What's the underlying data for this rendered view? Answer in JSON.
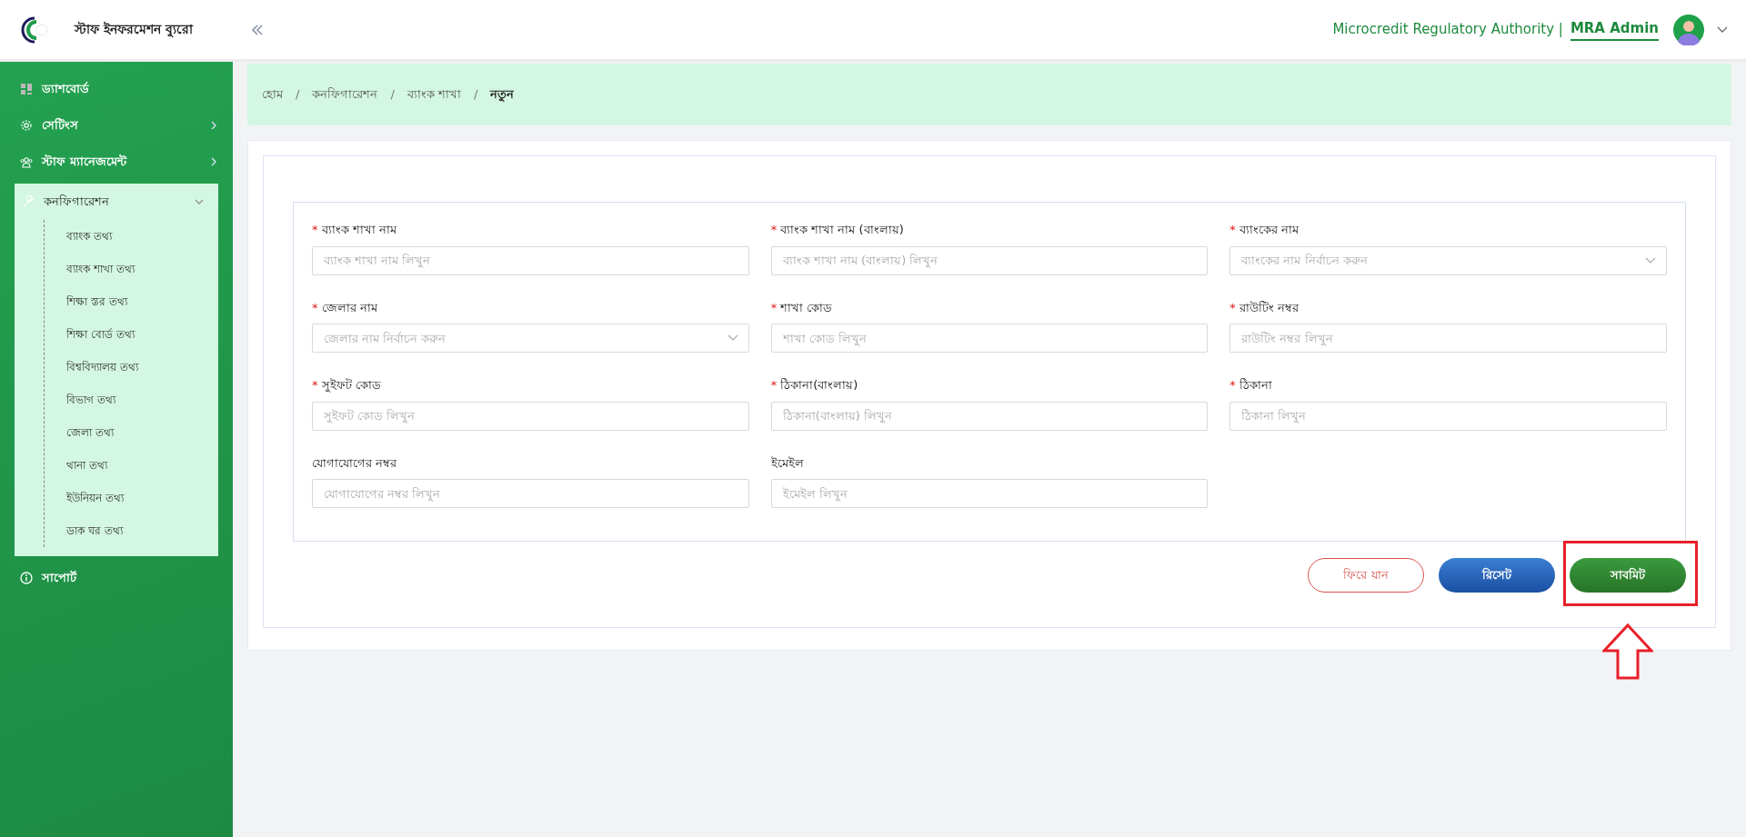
{
  "header": {
    "app_title": "স্টাফ ইনফরমেশন ব্যুরো",
    "organization": "Microcredit Regulatory Authority |",
    "user": "MRA Admin"
  },
  "sidebar": {
    "items": [
      {
        "label": "ড্যাশবোর্ড",
        "kind": "link"
      },
      {
        "label": "সেটিংস",
        "kind": "group",
        "expanded": false
      },
      {
        "label": "স্টাফ ম্যানেজমেন্ট",
        "kind": "group",
        "expanded": false
      },
      {
        "label": "কনফিগারেশন",
        "kind": "group",
        "expanded": true,
        "children": [
          {
            "label": "ব্যাংক তথ্য"
          },
          {
            "label": "ব্যাংক শাখা তথ্য"
          },
          {
            "label": "শিক্ষা স্তর তথ্য"
          },
          {
            "label": "শিক্ষা বোর্ড তথ্য"
          },
          {
            "label": "বিশ্ববিদ্যালয় তথ্য"
          },
          {
            "label": "বিভাগ তথ্য"
          },
          {
            "label": "জেলা তথ্য"
          },
          {
            "label": "থানা তথ্য"
          },
          {
            "label": "ইউনিয়ন তথ্য"
          },
          {
            "label": "ডাক ঘর তথ্য"
          }
        ]
      },
      {
        "label": "সাপোর্ট",
        "kind": "link"
      }
    ]
  },
  "breadcrumb": [
    {
      "label": "হোম",
      "current": false
    },
    {
      "separator": "/",
      "label": "কনফিগারেশন",
      "current": false
    },
    {
      "separator": "/",
      "label": "ব্যাংক শাখা",
      "current": false
    },
    {
      "separator": "/",
      "label": "নতুন",
      "current": true
    }
  ],
  "form": {
    "fields": [
      {
        "required_mark": "*",
        "label": "ব্যাংক শাখা নাম",
        "kind": "text",
        "placeholder": "ব্যাংক শাখা নাম লিখুন"
      },
      {
        "required_mark": "*",
        "label": "ব্যাংক শাখা নাম (বাংলায়)",
        "kind": "text",
        "placeholder": "ব্যাংক শাখা নাম (বাংলায়) লিখুন"
      },
      {
        "required_mark": "*",
        "label": "ব্যাংকের নাম",
        "kind": "select",
        "placeholder": "ব্যাংকের নাম নির্বাচন করুন"
      },
      {
        "required_mark": "*",
        "label": "জেলার নাম",
        "kind": "select",
        "placeholder": "জেলার নাম নির্বাচন করুন"
      },
      {
        "required_mark": "*",
        "label": "শাখা কোড",
        "kind": "text",
        "placeholder": "শাখা কোড লিখুন"
      },
      {
        "required_mark": "*",
        "label": "রাউটিং নম্বর",
        "kind": "text",
        "placeholder": "রাউটিং নম্বর লিখুন"
      },
      {
        "required_mark": "*",
        "label": "সুইফট কোড",
        "kind": "text",
        "placeholder": "সুইফট কোড লিখুন"
      },
      {
        "required_mark": "*",
        "label": "ঠিকানা(বাংলায়)",
        "kind": "text",
        "placeholder": "ঠিকানা(বাংলায়) লিখুন"
      },
      {
        "required_mark": "*",
        "label": "ঠিকানা",
        "kind": "text",
        "placeholder": "ঠিকানা লিখুন"
      },
      {
        "label": "যোগাযোগের নম্বর",
        "kind": "text",
        "placeholder": "যোগাযোগের নম্বর লিখুন"
      },
      {
        "label": "ইমেইল",
        "kind": "text",
        "placeholder": "ইমেইল লিখুন"
      }
    ],
    "buttons": [
      {
        "label": "ফিরে যান",
        "kind": "back",
        "highlighted": false
      },
      {
        "label": "রিসেট",
        "kind": "reset",
        "highlighted": false
      },
      {
        "label": "সাবমিট",
        "kind": "submit",
        "highlighted": true
      }
    ]
  }
}
